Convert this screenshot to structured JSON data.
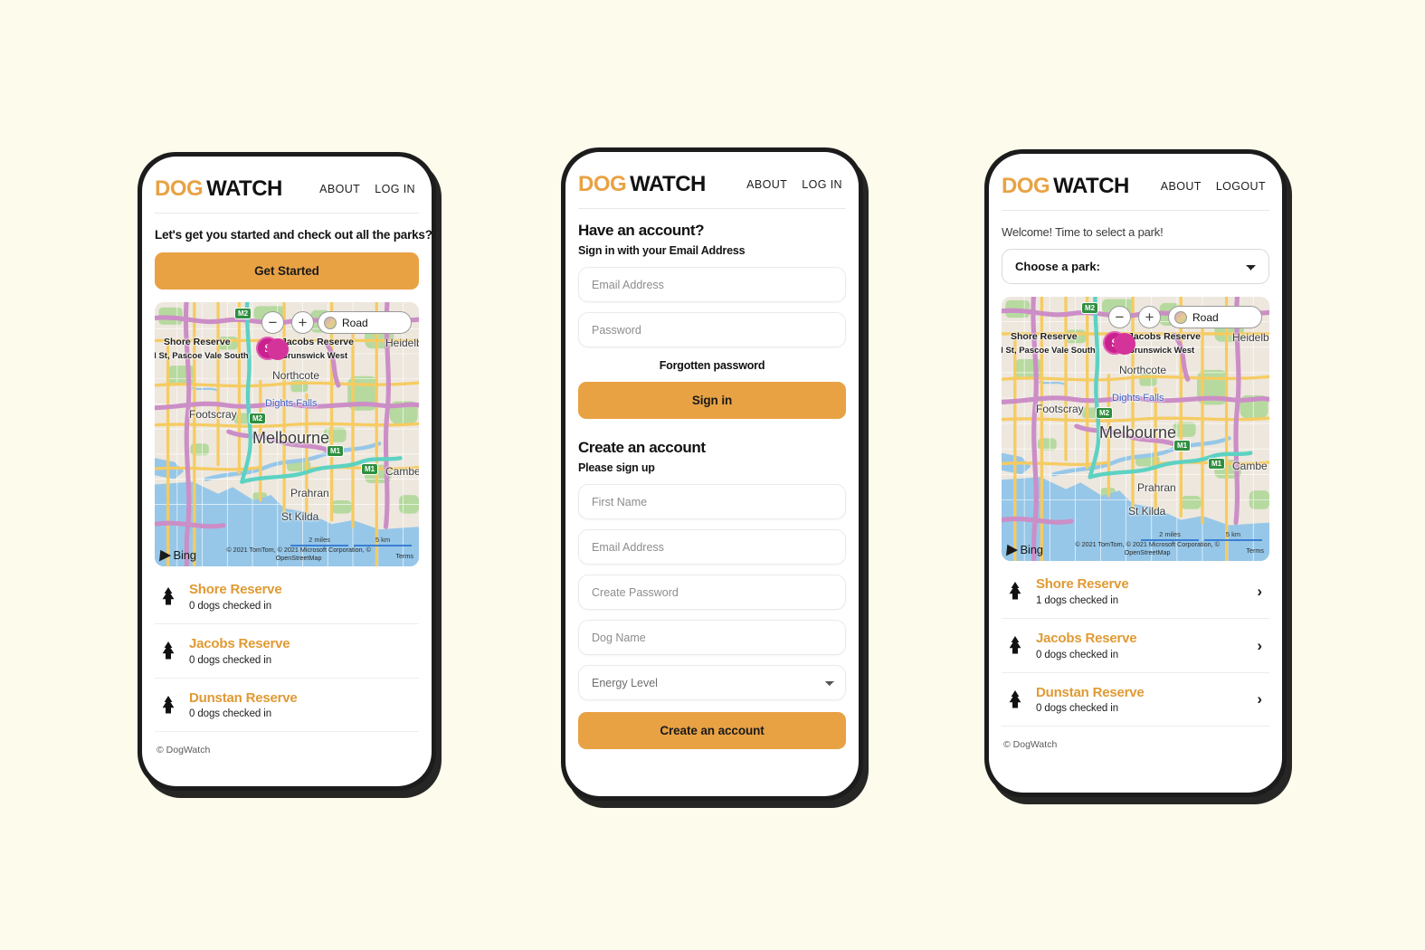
{
  "background_color": "#FDFBEC",
  "accent_color": "#E8A244",
  "park_name_color": "#E09A33",
  "brand": {
    "part1": "DOG",
    "part2": "WATCH"
  },
  "screen1": {
    "nav": {
      "about": "ABOUT",
      "login": "LOG IN"
    },
    "intro": "Let's get you started and check out all the parks?",
    "cta": "Get Started",
    "footer": "© DogWatch",
    "parks": [
      {
        "name": "Shore Reserve",
        "count": "0 dogs checked in"
      },
      {
        "name": "Jacobs Reserve",
        "count": "0 dogs checked in"
      },
      {
        "name": "Dunstan Reserve",
        "count": "0 dogs checked in"
      }
    ]
  },
  "screen2": {
    "nav": {
      "about": "ABOUT",
      "login": "LOG IN"
    },
    "signin": {
      "title": "Have an account?",
      "subtitle": "Sign in with your Email Address",
      "email_placeholder": "Email Address",
      "password_placeholder": "Password",
      "forgot": "Forgotten password",
      "button": "Sign in"
    },
    "signup": {
      "title": "Create an account",
      "subtitle": "Please sign up",
      "first_name_placeholder": "First Name",
      "email_placeholder": "Email Address",
      "password_placeholder": "Create Password",
      "dog_name_placeholder": "Dog Name",
      "energy_selected": "Energy Level",
      "energy_options": [
        "Energy Level"
      ],
      "button": "Create an account"
    }
  },
  "screen3": {
    "nav": {
      "about": "ABOUT",
      "logout": "LOGOUT"
    },
    "welcome": "Welcome! Time to select a park!",
    "park_select_selected": "Choose a park:",
    "park_select_options": [
      "Choose a park:"
    ],
    "footer": "© DogWatch",
    "parks": [
      {
        "name": "Shore Reserve",
        "count": "1 dogs checked in",
        "chevron": "›"
      },
      {
        "name": "Jacobs Reserve",
        "count": "0 dogs checked in",
        "chevron": "›"
      },
      {
        "name": "Dunstan Reserve",
        "count": "0 dogs checked in",
        "chevron": "›"
      }
    ]
  },
  "map": {
    "provider": "Bing",
    "zoom_out": "−",
    "zoom_in": "+",
    "style_label": "Road",
    "attribution": "© 2021 TomTom, © 2021 Microsoft Corporation, © OpenStreetMap",
    "terms": "Terms",
    "scale_miles": "2 miles",
    "scale_km": "5 km",
    "pin_letter": "S",
    "labels": {
      "shore": "Shore Reserve",
      "shore_sub": "d St, Pascoe Vale South",
      "jacobs": "Jacobs Reserve",
      "jacobs_sub": "Brunswick West",
      "northcote": "Northcote",
      "footscray": "Footscray",
      "dights": "Dights Falls",
      "melbourne": "Melbourne",
      "prahran": "Prahran",
      "stkilda": "St Kilda",
      "heidelberg": "Heidelb",
      "camberwell": "Cambe",
      "m2a": "M2",
      "m2b": "M2",
      "m1a": "M1",
      "m1b": "M1"
    }
  }
}
